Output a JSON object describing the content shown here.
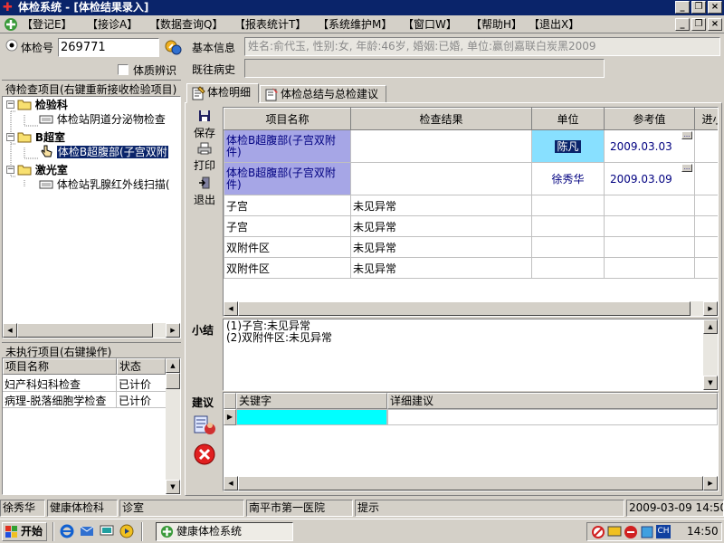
{
  "window": {
    "title": "体检系统 - [体检结果录入]"
  },
  "menu": [
    "【登记E】",
    "【接诊A】",
    "【数据查询Q】",
    "【报表统计T】",
    "【系统维护M】",
    "【窗口W】",
    "【帮助H】",
    "【退出X】"
  ],
  "left": {
    "exam_no_label": "体检号",
    "exam_no_value": "269771",
    "constitution_label": "体质辨识",
    "pending_title": "待检查项目(右键重新接收检验项目)",
    "tree": [
      {
        "label": "检验科",
        "depth": 0,
        "type": "dept"
      },
      {
        "label": "体检站阴道分泌物检查",
        "depth": 1,
        "type": "item"
      },
      {
        "label": "B超室",
        "depth": 0,
        "type": "dept"
      },
      {
        "label": "体检B超腹部(子宫双附",
        "depth": 1,
        "type": "item",
        "selected": true
      },
      {
        "label": "激光室",
        "depth": 0,
        "type": "dept"
      },
      {
        "label": "体检站乳腺红外线扫描(",
        "depth": 1,
        "type": "item"
      }
    ],
    "unexec_title": "未执行项目(右键操作)",
    "unexec_headers": [
      "项目名称",
      "状态"
    ],
    "unexec_rows": [
      [
        "妇产科妇科检查",
        "已计价"
      ],
      [
        "病理-脱落细胞学检查",
        "已计价"
      ]
    ]
  },
  "info": {
    "basic_label": "基本信息",
    "basic_value": "姓名:俞代玉, 性别:女, 年龄:46岁, 婚姻:已婚, 单位:赢创嘉联白炭黑2009",
    "history_label": "既往病史"
  },
  "tabs": [
    "体检明细",
    "体检总结与总检建议"
  ],
  "actions": {
    "save": "保存",
    "print": "打印",
    "exit": "退出"
  },
  "grid": {
    "headers": [
      "项目名称",
      "检查结果",
      "单位",
      "参考值",
      "进小"
    ],
    "rows": [
      [
        "体检B超腹部(子宫双附件)",
        "",
        "陈凡",
        "2009.03.03"
      ],
      [
        "体检B超腹部(子宫双附件)",
        "",
        "徐秀华",
        "2009.03.09"
      ],
      [
        "子宫",
        "未见异常",
        "",
        ""
      ],
      [
        "子宫",
        "未见异常",
        "",
        ""
      ],
      [
        "双附件区",
        "未见异常",
        "",
        ""
      ],
      [
        "双附件区",
        "未见异常",
        "",
        ""
      ]
    ]
  },
  "summary": {
    "label": "小结",
    "lines": [
      "(1)子宫:未见异常",
      "(2)双附件区:未见异常"
    ]
  },
  "advice": {
    "label": "建议",
    "headers": [
      "关键字",
      "详细建议"
    ]
  },
  "status": [
    "徐秀华",
    "健康体检科",
    "诊室",
    "南平市第一医院",
    "提示",
    "2009-03-09 14:50"
  ],
  "taskbar": {
    "start": "开始",
    "app": "健康体检系统",
    "lang": "CH",
    "time": "14:50"
  },
  "colors": {
    "title_bg": "#0a246a",
    "selected_row": "#a6a6e6",
    "cyan": "#00ffff",
    "light_cyan": "#88e0ff",
    "date_text": "#000080"
  }
}
